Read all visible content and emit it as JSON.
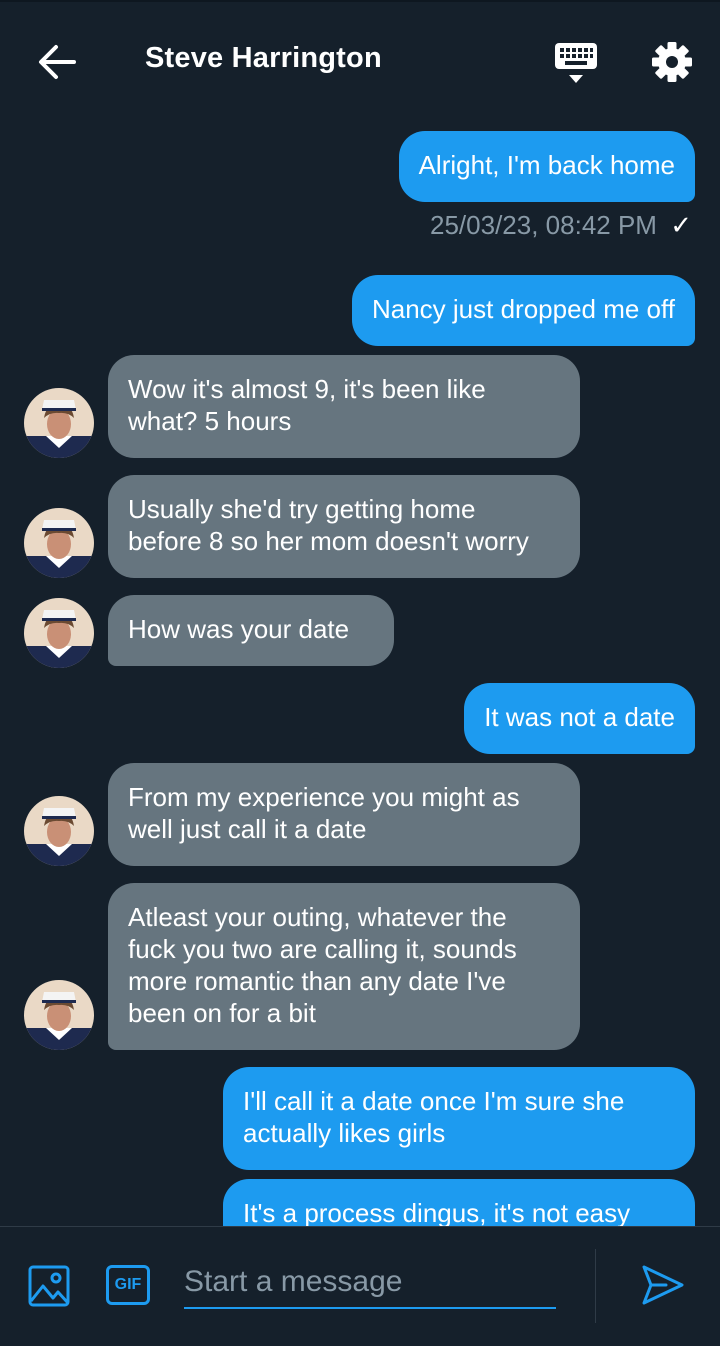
{
  "header": {
    "title": "Steve Harrington",
    "icons": {
      "back": "arrow-left-icon",
      "keyboard": "keyboard-icon",
      "settings": "gear-icon"
    }
  },
  "messages": [
    {
      "side": "out",
      "text": "Alright, I'm back home"
    },
    {
      "side": "out",
      "text": "Nancy just dropped me off"
    },
    {
      "side": "in",
      "text": "Wow it's almost 9, it's been like\nwhat? 5 hours"
    },
    {
      "side": "in",
      "text": "Usually she'd try getting home\nbefore 8 so her mom doesn't worry"
    },
    {
      "side": "in",
      "text": "How was your date"
    },
    {
      "side": "out",
      "text": "It was not a date"
    },
    {
      "side": "in",
      "text": "From my experience you might as\nwell just call it a date"
    },
    {
      "side": "in",
      "text": "Atleast your outing, whatever the\nfuck you two are calling it, sounds\nmore romantic than any date I've\nbeen on for a bit"
    },
    {
      "side": "out",
      "text": "I'll call it a date once I'm sure she\nactually likes girls"
    },
    {
      "side": "out",
      "text": "It's a process dingus, it's not easy"
    }
  ],
  "timestamp": "25/03/23, 08:42 PM",
  "read_mark": "✓",
  "composer": {
    "placeholder": "Start a message",
    "gif_label": "GIF",
    "icons": {
      "image": "image-icon",
      "send": "send-icon"
    }
  },
  "colors": {
    "background": "#15202b",
    "outgoing_bubble": "#1d9bf0",
    "incoming_bubble": "#66757f",
    "muted_text": "#8899a6"
  }
}
